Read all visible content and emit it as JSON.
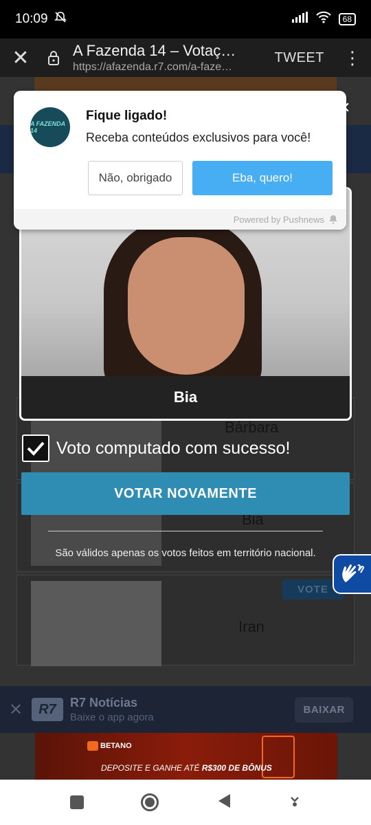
{
  "status_bar": {
    "time": "10:09",
    "battery": "68"
  },
  "toolbar": {
    "title": "A Fazenda 14 – Votaç…",
    "url": "https://afazenda.r7.com/a-faze…",
    "tweet_label": "TWEET"
  },
  "push_prompt": {
    "logo_text": "A FAZENDA 14",
    "title": "Fique ligado!",
    "body": "Receba conteúdos exclusivos para você!",
    "decline_label": "Não, obrigado",
    "accept_label": "Eba, quero!",
    "footer": "Powered by Pushnews"
  },
  "vote_card": {
    "candidate_name": "Bia"
  },
  "background_list": {
    "names": [
      "Bárbara",
      "Bia",
      "Iran"
    ],
    "vote_label": "VOTE"
  },
  "result": {
    "message": "Voto computado com sucesso!",
    "checked": true
  },
  "vote_again_label": "VOTAR NOVAMENTE",
  "disclaimer": "São válidos apenas os votos feitos em território nacional.",
  "app_banner": {
    "logo": "R7",
    "title": "R7 Notícias",
    "subtitle": "Baixe o app agora",
    "button_label": "BAIXAR"
  },
  "ad": {
    "brand": "BETANO",
    "text_prefix": "DEPOSITE E GANHE ATÉ ",
    "text_bold": "R$300 DE BÔNUS"
  },
  "colors": {
    "accent": "#2f8db4",
    "push_accept": "#48aef3",
    "a11y": "#0f4aa3"
  }
}
